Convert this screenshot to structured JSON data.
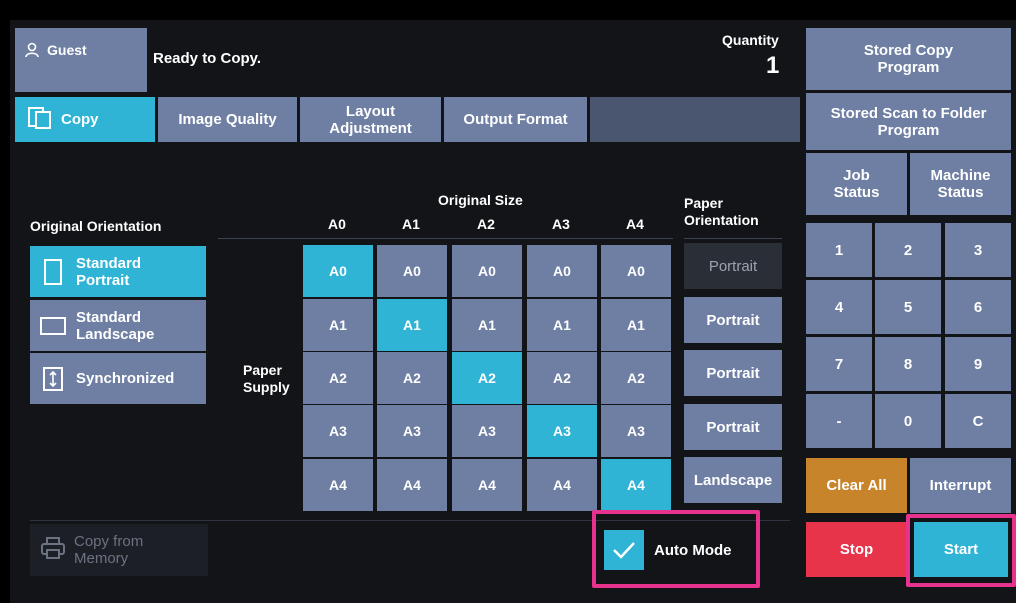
{
  "header": {
    "user_label": "Guest",
    "status": "Ready to Copy.",
    "quantity_label": "Quantity",
    "quantity_value": "1"
  },
  "tabs": [
    {
      "label": "Copy",
      "active": true
    },
    {
      "label": "Image Quality"
    },
    {
      "label": "Layout Adjustment"
    },
    {
      "label": "Output Format"
    }
  ],
  "orientation": {
    "title": "Original Orientation",
    "options": [
      "Standard Portrait",
      "Standard Landscape",
      "Synchronized"
    ],
    "selected": "Standard Portrait"
  },
  "grid": {
    "original_size_title": "Original Size",
    "paper_supply_label": "Paper Supply",
    "columns": [
      "A0",
      "A1",
      "A2",
      "A3",
      "A4"
    ],
    "rows": [
      "A0",
      "A1",
      "A2",
      "A3",
      "A4"
    ],
    "paper_orientation_title": "Paper Orientation",
    "paper_orientations": [
      "Portrait",
      "Portrait",
      "Portrait",
      "Portrait",
      "Landscape"
    ]
  },
  "footer": {
    "copy_from_memory": "Copy from Memory",
    "auto_mode": "Auto Mode",
    "auto_mode_checked": true
  },
  "right_panel": {
    "stored_copy": "Stored Copy Program",
    "stored_scan": "Stored Scan to Folder Program",
    "job_status": "Job Status",
    "machine_status": "Machine Status",
    "keys": [
      "1",
      "2",
      "3",
      "4",
      "5",
      "6",
      "7",
      "8",
      "9",
      "-",
      "0",
      "C"
    ],
    "clear_all": "Clear All",
    "interrupt": "Interrupt",
    "stop": "Stop",
    "start": "Start"
  },
  "colors": {
    "accent": "#2fb4d6",
    "button": "#6e7fa3",
    "clear_all": "#c8842a",
    "stop": "#e8344a",
    "highlight": "#e8338e"
  }
}
